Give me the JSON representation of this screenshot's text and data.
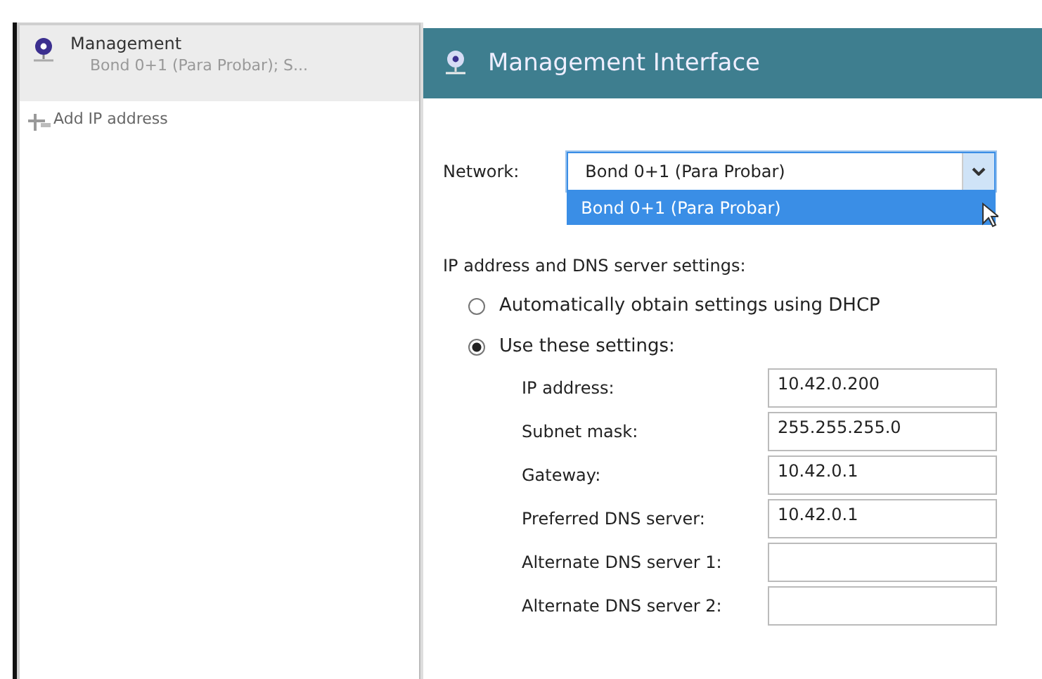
{
  "sidebar": {
    "items": [
      {
        "kind": "network",
        "title": "Management",
        "subtitle": "Bond 0+1 (Para Probar); S...",
        "selected": true
      },
      {
        "kind": "add",
        "title": "Add IP address",
        "selected": false
      }
    ]
  },
  "panel": {
    "title": "Management Interface",
    "network": {
      "label": "Network:",
      "value": "Bond 0+1 (Para Probar)",
      "expanded": true,
      "options": [
        {
          "label": "Bond 0+1 (Para Probar)",
          "selected": true
        }
      ]
    },
    "section_title": "IP address and DNS server settings:",
    "modes": [
      {
        "label": "Automatically obtain settings using DHCP",
        "selected": false
      },
      {
        "label": "Use these settings:",
        "selected": true
      }
    ],
    "fields": [
      {
        "label": "IP address:",
        "value": "10.42.0.200"
      },
      {
        "label": "Subnet mask:",
        "value": "255.255.255.0"
      },
      {
        "label": "Gateway:",
        "value": "10.42.0.1"
      },
      {
        "label": "Preferred DNS server:",
        "value": "10.42.0.1"
      },
      {
        "label": "Alternate DNS server 1:"
      },
      {
        "label": "Alternate DNS server 2:"
      }
    ]
  }
}
